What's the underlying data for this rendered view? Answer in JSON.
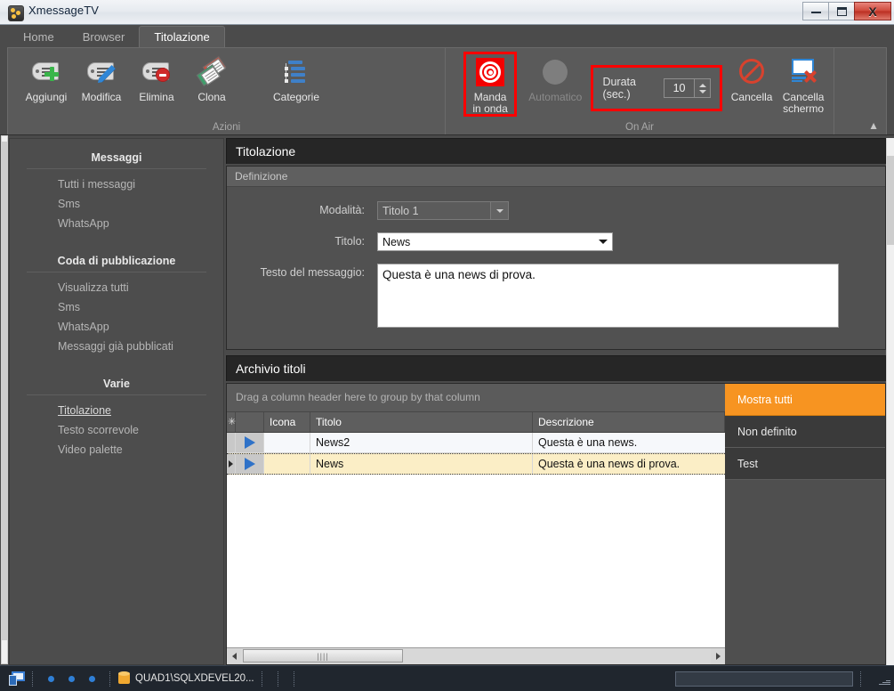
{
  "window": {
    "title": "XmessageTV",
    "app_icon": "app-icon",
    "minimize_label": "Minimize",
    "maximize_label": "Maximize",
    "close_label": "X"
  },
  "ribbon": {
    "tabs": [
      {
        "label": "Home",
        "active": false
      },
      {
        "label": "Browser",
        "active": false
      },
      {
        "label": "Titolazione",
        "active": true
      }
    ],
    "groups": [
      {
        "label": "Azioni",
        "buttons": [
          {
            "label": "Aggiungi",
            "icon": "tag-add-icon",
            "enabled": true
          },
          {
            "label": "Modifica",
            "icon": "tag-edit-icon",
            "enabled": true
          },
          {
            "label": "Elimina",
            "icon": "tag-delete-icon",
            "enabled": true
          },
          {
            "label": "Clona",
            "icon": "tag-clone-icon",
            "enabled": true
          },
          {
            "label": "Categorie",
            "icon": "categories-icon",
            "enabled": true
          }
        ]
      },
      {
        "label": "On Air",
        "buttons": [
          {
            "label_line1": "Manda",
            "label_line2": "in onda",
            "icon": "broadcast-target-icon",
            "enabled": true,
            "highlighted": true
          },
          {
            "label": "Automatico",
            "icon": "automatic-circle-icon",
            "enabled": false
          },
          {
            "label": "Cancella",
            "icon": "no-entry-icon",
            "enabled": true
          },
          {
            "label_line1": "Cancella",
            "label_line2": "schermo",
            "icon": "clear-screen-icon",
            "enabled": true
          }
        ],
        "duration": {
          "label": "Durata (sec.)",
          "value": "10",
          "highlighted": true
        }
      }
    ],
    "collapse_icon": "chevron-up-icon"
  },
  "sidebar": {
    "groups": [
      {
        "header": "Messaggi",
        "items": [
          {
            "label": "Tutti i messaggi",
            "active": false
          },
          {
            "label": "Sms",
            "active": false
          },
          {
            "label": "WhatsApp",
            "active": false
          }
        ]
      },
      {
        "header": "Coda di pubblicazione",
        "items": [
          {
            "label": "Visualizza tutti",
            "active": false
          },
          {
            "label": "Sms",
            "active": false
          },
          {
            "label": "WhatsApp",
            "active": false
          },
          {
            "label": "Messaggi già pubblicati",
            "active": false
          }
        ]
      },
      {
        "header": "Varie",
        "items": [
          {
            "label": "Titolazione",
            "active": true
          },
          {
            "label": "Testo scorrevole",
            "active": false
          },
          {
            "label": "Video palette",
            "active": false
          }
        ]
      }
    ]
  },
  "definition_panel": {
    "title": "Titolazione",
    "subheader": "Definizione",
    "fields": {
      "modalita_label": "Modalità:",
      "modalita_value": "Titolo 1",
      "titolo_label": "Titolo:",
      "titolo_value": "News",
      "testo_label": "Testo del messaggio:",
      "testo_value": "Questa è una news di prova."
    }
  },
  "archive_panel": {
    "title": "Archivio titoli",
    "group_band": "Drag a column header here to group by that column",
    "columns": [
      "✳",
      "",
      "Icona",
      "Titolo",
      "Descrizione"
    ],
    "rows": [
      {
        "indicator": "",
        "icon": "play-icon",
        "icona": "",
        "titolo": "News2",
        "descrizione": "Questa è una news.",
        "selected": false
      },
      {
        "indicator": "▸",
        "icon": "play-icon",
        "icona": "",
        "titolo": "News",
        "descrizione": "Questa è una news di prova.",
        "selected": true
      }
    ],
    "filters": [
      {
        "label": "Mostra tutti",
        "active": true
      },
      {
        "label": "Non definito",
        "active": false
      },
      {
        "label": "Test",
        "active": false
      }
    ]
  },
  "statusbar": {
    "monitor_icon": "monitor-icon",
    "dots": 3,
    "db_icon": "database-icon",
    "connection": "QUAD1\\SQLXDEVEL20...",
    "field_value": ""
  },
  "colors": {
    "accent_orange": "#f79421",
    "highlight_red": "#ff0000",
    "row_selected": "#fbeec6",
    "window_bg": "#4a4a4a",
    "panel_bg": "#4f4f4f",
    "title_bar_dark": "#262626",
    "statusbar_bg": "#20262e"
  }
}
